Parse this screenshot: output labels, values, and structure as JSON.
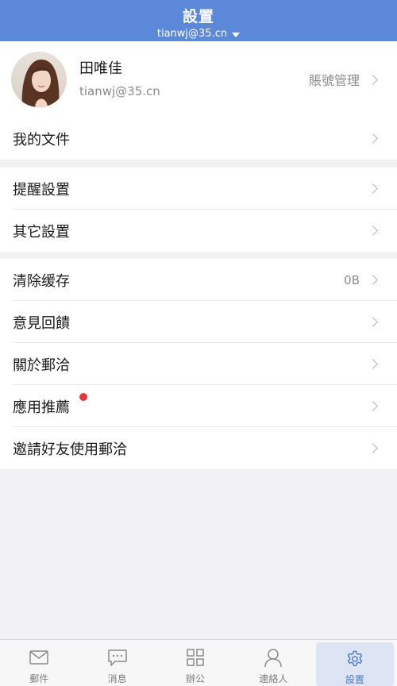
{
  "header": {
    "title": "設置",
    "account": "tianwj@35.cn"
  },
  "profile": {
    "name": "田唯佳",
    "email": "tianwj@35.cn",
    "manage_label": "賬號管理"
  },
  "groups": [
    {
      "items": [
        {
          "label": "我的文件"
        }
      ]
    },
    {
      "items": [
        {
          "label": "提醒設置"
        },
        {
          "label": "其它設置"
        }
      ]
    },
    {
      "items": [
        {
          "label": "清除缓存",
          "value": "0B"
        },
        {
          "label": "意見回饋"
        },
        {
          "label": "關於郵洽"
        },
        {
          "label": "應用推薦",
          "badge": "new"
        },
        {
          "label": "邀請好友使用郵洽"
        }
      ]
    }
  ],
  "tabs": [
    {
      "label": "郵件",
      "icon": "mail-icon"
    },
    {
      "label": "消息",
      "icon": "chat-icon"
    },
    {
      "label": "辦公",
      "icon": "grid-icon"
    },
    {
      "label": "連絡人",
      "icon": "contact-icon"
    },
    {
      "label": "設置",
      "icon": "gear-icon",
      "active": true
    }
  ],
  "colors": {
    "header": "#5b88d9",
    "accent": "#4a78c7",
    "badge": "#e53935"
  }
}
